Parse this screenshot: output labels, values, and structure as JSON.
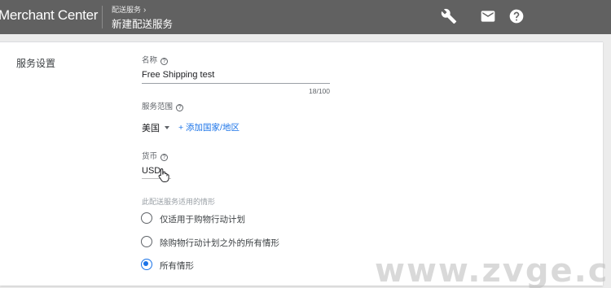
{
  "header": {
    "brand": "Merchant Center",
    "breadcrumb": "配送服务",
    "breadcrumb_chevron": "›",
    "title": "新建配送服务",
    "icons": [
      "wrench-icon",
      "mail-icon",
      "help-icon"
    ]
  },
  "section": {
    "title": "服务设置"
  },
  "name_field": {
    "label": "名称",
    "value": "Free Shipping test",
    "counter": "18/100"
  },
  "scope_field": {
    "label": "服务范围",
    "country": "美国",
    "add_link": "+ 添加国家/地区"
  },
  "currency_field": {
    "label": "货币",
    "value": "USD"
  },
  "usage": {
    "label": "此配送服务适用的情形",
    "options": [
      {
        "label": "仅适用于购物行动计划",
        "selected": false
      },
      {
        "label": "除购物行动计划之外的所有情形",
        "selected": false
      },
      {
        "label": "所有情形",
        "selected": true
      }
    ]
  },
  "watermark": "www.zvge.cn",
  "colors": {
    "header_bg": "#616161",
    "accent": "#1a73e8"
  }
}
